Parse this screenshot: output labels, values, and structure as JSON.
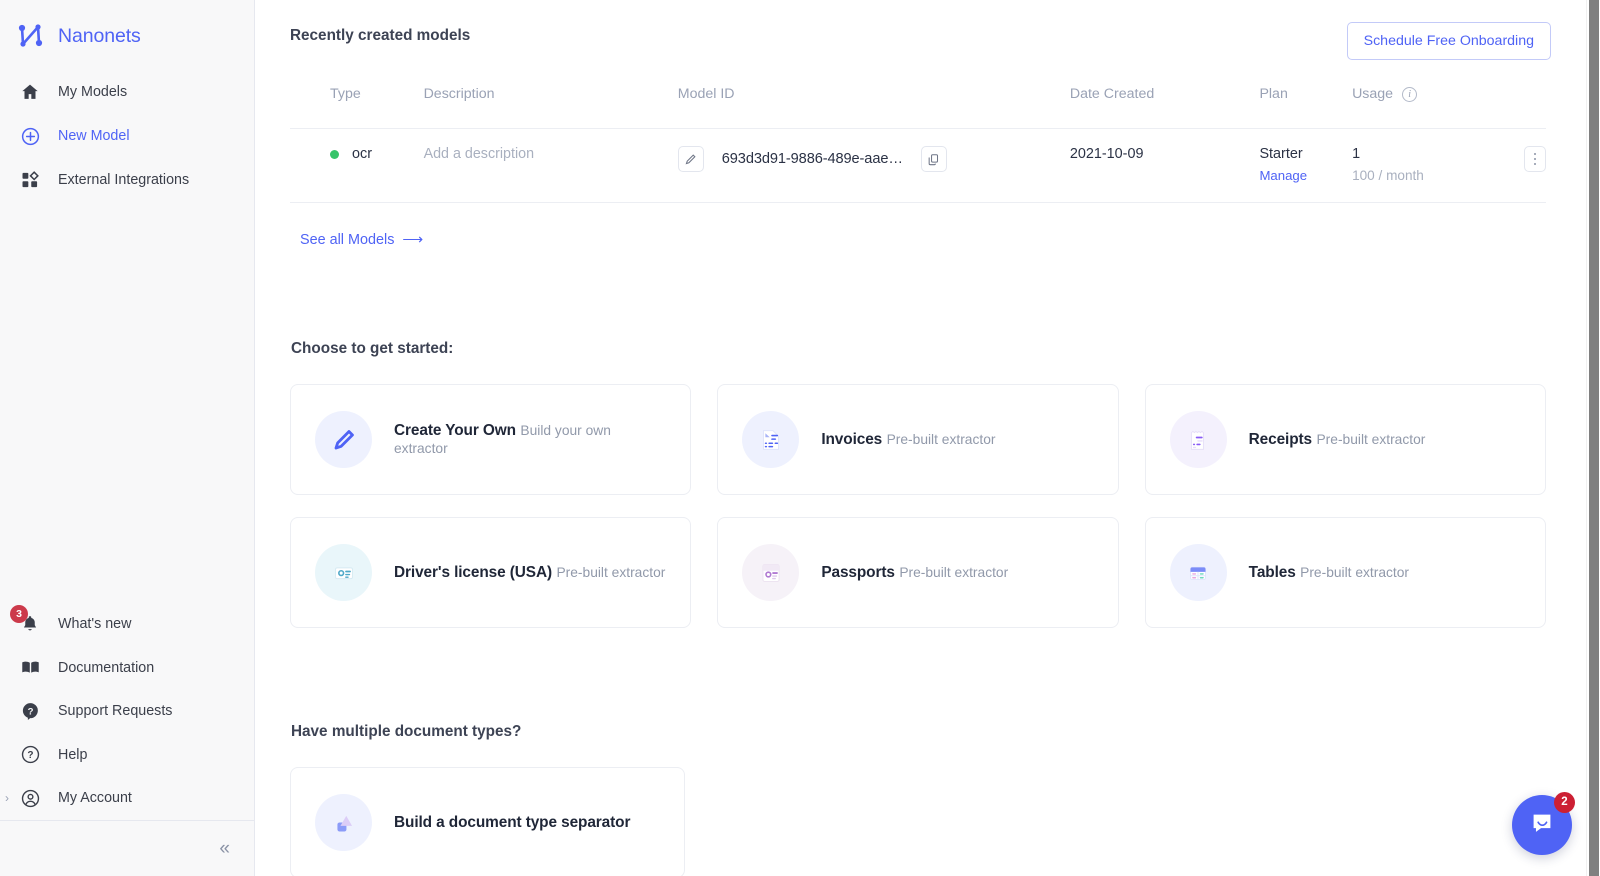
{
  "brand": {
    "name": "Nanonets",
    "logo_icon": "nanonets-logo-icon"
  },
  "sidebar": {
    "top_items": [
      {
        "label": "My Models",
        "icon": "home-icon",
        "accent": false
      },
      {
        "label": "New Model",
        "icon": "plus-circle-icon",
        "accent": true
      },
      {
        "label": "External Integrations",
        "icon": "integrations-grid-icon",
        "accent": false
      }
    ],
    "bottom_items": [
      {
        "label": "What's new",
        "icon": "bell-icon",
        "badge": "3"
      },
      {
        "label": "Documentation",
        "icon": "book-icon"
      },
      {
        "label": "Support Requests",
        "icon": "support-chat-icon"
      },
      {
        "label": "Help",
        "icon": "question-circle-icon"
      },
      {
        "label": "My Account",
        "icon": "user-circle-icon",
        "caret": "›"
      }
    ],
    "collapse_label": "«"
  },
  "models_section": {
    "title": "Recently created models",
    "onboarding_button": "Schedule Free Onboarding",
    "see_all_label": "See all Models",
    "see_all_arrow": "⟶",
    "columns": {
      "type": "Type",
      "description": "Description",
      "model_id": "Model ID",
      "date_created": "Date Created",
      "plan": "Plan",
      "usage": "Usage"
    },
    "usage_info_icon": "info-icon",
    "rows": [
      {
        "type": "ocr",
        "status_color": "#37c46a",
        "description_placeholder": "Add a description",
        "edit_icon": "pencil-icon",
        "model_id": "693d3d91-9886-489e-aae…",
        "copy_icon": "copy-icon",
        "date_created": "2021-10-09",
        "plan": "Starter",
        "plan_action": "Manage",
        "usage_count": "1",
        "usage_limit": "100 / month",
        "row_menu_icon": "kebab-menu-icon"
      }
    ]
  },
  "get_started": {
    "heading": "Choose to get started:",
    "cards": [
      {
        "title": "Create Your Own",
        "subtitle": "Build your own extractor",
        "icon": "pencil-icon",
        "bg": "bg-indigo"
      },
      {
        "title": "Invoices",
        "subtitle": "Pre-built extractor",
        "icon": "invoice-doc-icon",
        "bg": "bg-indigo"
      },
      {
        "title": "Receipts",
        "subtitle": "Pre-built extractor",
        "icon": "receipt-icon",
        "bg": "bg-violet"
      },
      {
        "title": "Driver's license (USA)",
        "subtitle": "Pre-built extractor",
        "icon": "id-card-icon",
        "bg": "bg-cyan"
      },
      {
        "title": "Passports",
        "subtitle": "Pre-built extractor",
        "icon": "passport-icon",
        "bg": "bg-mauve"
      },
      {
        "title": "Tables",
        "subtitle": "Pre-built extractor",
        "icon": "table-grid-icon",
        "bg": "bg-indigo"
      }
    ]
  },
  "multi_doc": {
    "heading": "Have multiple document types?",
    "cards": [
      {
        "title": "Build a document type separator",
        "icon": "shapes-separator-icon",
        "bg": "bg-indigo"
      }
    ]
  },
  "intercom": {
    "badge": "2",
    "icon": "intercom-chat-icon"
  },
  "colors": {
    "accent": "#4f63f5",
    "status_green": "#37c46a",
    "badge_red": "#cc3a4b",
    "sidebar_bg": "#f8f8f9"
  }
}
